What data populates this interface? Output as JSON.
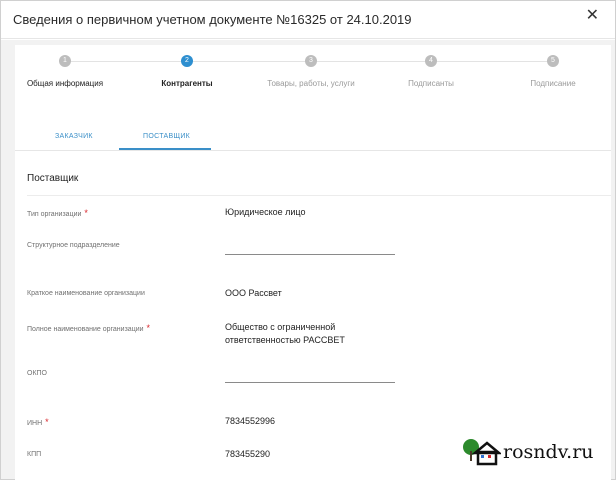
{
  "dialog": {
    "title": "Сведения о первичном учетном документе №16325 от 24.10.2019",
    "close_icon": "close-icon"
  },
  "stepper": {
    "steps": [
      {
        "number": "1",
        "label": "Общая информация",
        "state": "done"
      },
      {
        "number": "2",
        "label": "Контрагенты",
        "state": "active"
      },
      {
        "number": "3",
        "label": "Товары, работы, услуги",
        "state": "pending"
      },
      {
        "number": "4",
        "label": "Подписанты",
        "state": "pending"
      },
      {
        "number": "5",
        "label": "Подписание",
        "state": "pending"
      }
    ]
  },
  "tabs": {
    "items": [
      {
        "label": "ЗАКАЗЧИК",
        "selected": false
      },
      {
        "label": "ПОСТАВЩИК",
        "selected": true
      }
    ]
  },
  "form": {
    "section_title": "Поставщик",
    "required_mark": "*",
    "fields": {
      "org_type": {
        "label": "Тип организации",
        "value": "Юридическое лицо",
        "required": true
      },
      "division": {
        "label": "Структурное подразделение",
        "value": ""
      },
      "short_name": {
        "label": "Краткое наименование организации",
        "value": "ООО Рассвет"
      },
      "full_name": {
        "label": "Полное наименование организации",
        "value": "Общество с ограниченной ответственностью РАССВЕТ",
        "required": true
      },
      "okpo": {
        "label": "ОКПО",
        "value": ""
      },
      "inn": {
        "label": "ИНН",
        "value": "7834552996",
        "required": true
      },
      "kpp": {
        "label": "КПП",
        "value": "783455290"
      }
    }
  },
  "watermark": {
    "text": "rosndv.ru",
    "icon": "house-tree-logo-icon"
  },
  "colors": {
    "accent": "#2e8fd0",
    "required": "#d8262b",
    "logo_green": "#2c8a2c"
  }
}
